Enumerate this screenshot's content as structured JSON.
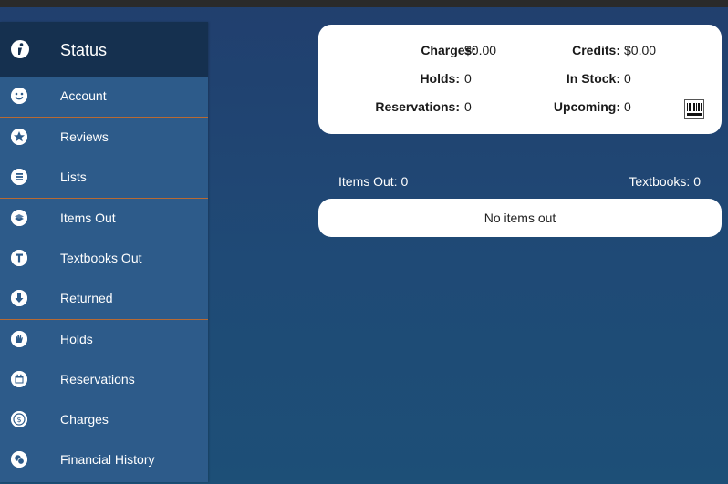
{
  "sidebar": {
    "header": {
      "title": "Status",
      "icon": "info-icon"
    },
    "items": [
      {
        "label": "Account",
        "icon": "smile-icon"
      },
      {
        "label": "Reviews",
        "icon": "star-icon"
      },
      {
        "label": "Lists",
        "icon": "list-icon"
      },
      {
        "label": "Items Out",
        "icon": "books-icon"
      },
      {
        "label": "Textbooks Out",
        "icon": "textbook-icon"
      },
      {
        "label": "Returned",
        "icon": "return-arrow-icon"
      },
      {
        "label": "Holds",
        "icon": "hand-icon"
      },
      {
        "label": "Reservations",
        "icon": "calendar-icon"
      },
      {
        "label": "Charges",
        "icon": "dollar-icon"
      },
      {
        "label": "Financial History",
        "icon": "coins-icon"
      }
    ]
  },
  "summary": {
    "charges_label": "Charges:",
    "charges_value": "$0.00",
    "credits_label": "Credits:",
    "credits_value": "$0.00",
    "holds_label": "Holds:",
    "holds_value": "0",
    "in_stock_label": "In Stock:",
    "in_stock_value": "0",
    "reservations_label": "Reservations:",
    "reservations_value": "0",
    "upcoming_label": "Upcoming:",
    "upcoming_value": "0",
    "barcode_icon": "barcode-icon"
  },
  "items_out": {
    "count_label": "Items Out: 0",
    "textbooks_label": "Textbooks: 0",
    "empty_message": "No items out"
  },
  "colors": {
    "sidebar_bg": "#2d5b8a",
    "sidebar_header_bg": "#15304f",
    "separator": "#b86a33",
    "page_bg": "#214370"
  }
}
